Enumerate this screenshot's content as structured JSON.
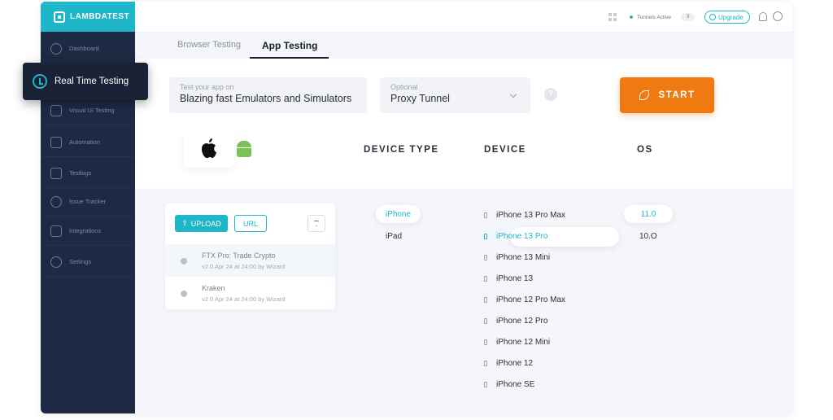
{
  "brand": {
    "name": "LAMBDATEST"
  },
  "sidebar": {
    "items": [
      {
        "label": "Dashboard",
        "icon": "dashboard-icon"
      },
      {
        "label": "Visual UI Testing",
        "icon": "visual-ui-icon"
      },
      {
        "label": "Automation",
        "icon": "automation-icon"
      },
      {
        "label": "Testlogs",
        "icon": "testlogs-icon"
      },
      {
        "label": "Issue Tracker",
        "icon": "bug-icon"
      },
      {
        "label": "Integrations",
        "icon": "integrations-icon"
      },
      {
        "label": "Settings",
        "icon": "settings-icon"
      }
    ],
    "active": {
      "label": "Real Time Testing",
      "icon": "clock-icon"
    }
  },
  "topbar": {
    "tunnel_label": "Tunnels Active",
    "tunnel_count": "3",
    "upgrade_label": "Upgrade"
  },
  "tabs": {
    "browser": "Browser Testing",
    "app": "App Testing"
  },
  "config": {
    "app_field_placeholder": "Test your app on",
    "app_field_value": "Blazing fast Emulators and Simulators",
    "proxy_placeholder": "Optional",
    "proxy_value": "Proxy Tunnel",
    "help": "?",
    "start_label": "START"
  },
  "columns": {
    "device_type": "DEVICE TYPE",
    "device": "DEVICE",
    "os": "OS"
  },
  "apps": {
    "upload_label": "UPLOAD",
    "url_label": "URL",
    "items": [
      {
        "name": "FTX Pro: Trade Crypto",
        "meta": "v2.0 Apr 24 at 24:00 by Wizard"
      },
      {
        "name": "Kraken",
        "meta": "v2.0 Apr 24 at 24:00 by Wizard"
      }
    ]
  },
  "device_types": [
    "iPhone",
    "iPad"
  ],
  "devices": [
    "iPhone 13 Pro Max",
    "iPhone 13 Pro",
    "iPhone 13 Mini",
    "iPhone 13",
    "iPhone 12 Pro Max",
    "iPhone 12 Pro",
    "iPhone 12 Mini",
    "iPhone 12",
    "iPhone SE"
  ],
  "os_versions": [
    "11.0",
    "10.O"
  ],
  "colors": {
    "accent": "#1fb6c9",
    "start": "#f07a12",
    "sidebar": "#1e2a44"
  }
}
